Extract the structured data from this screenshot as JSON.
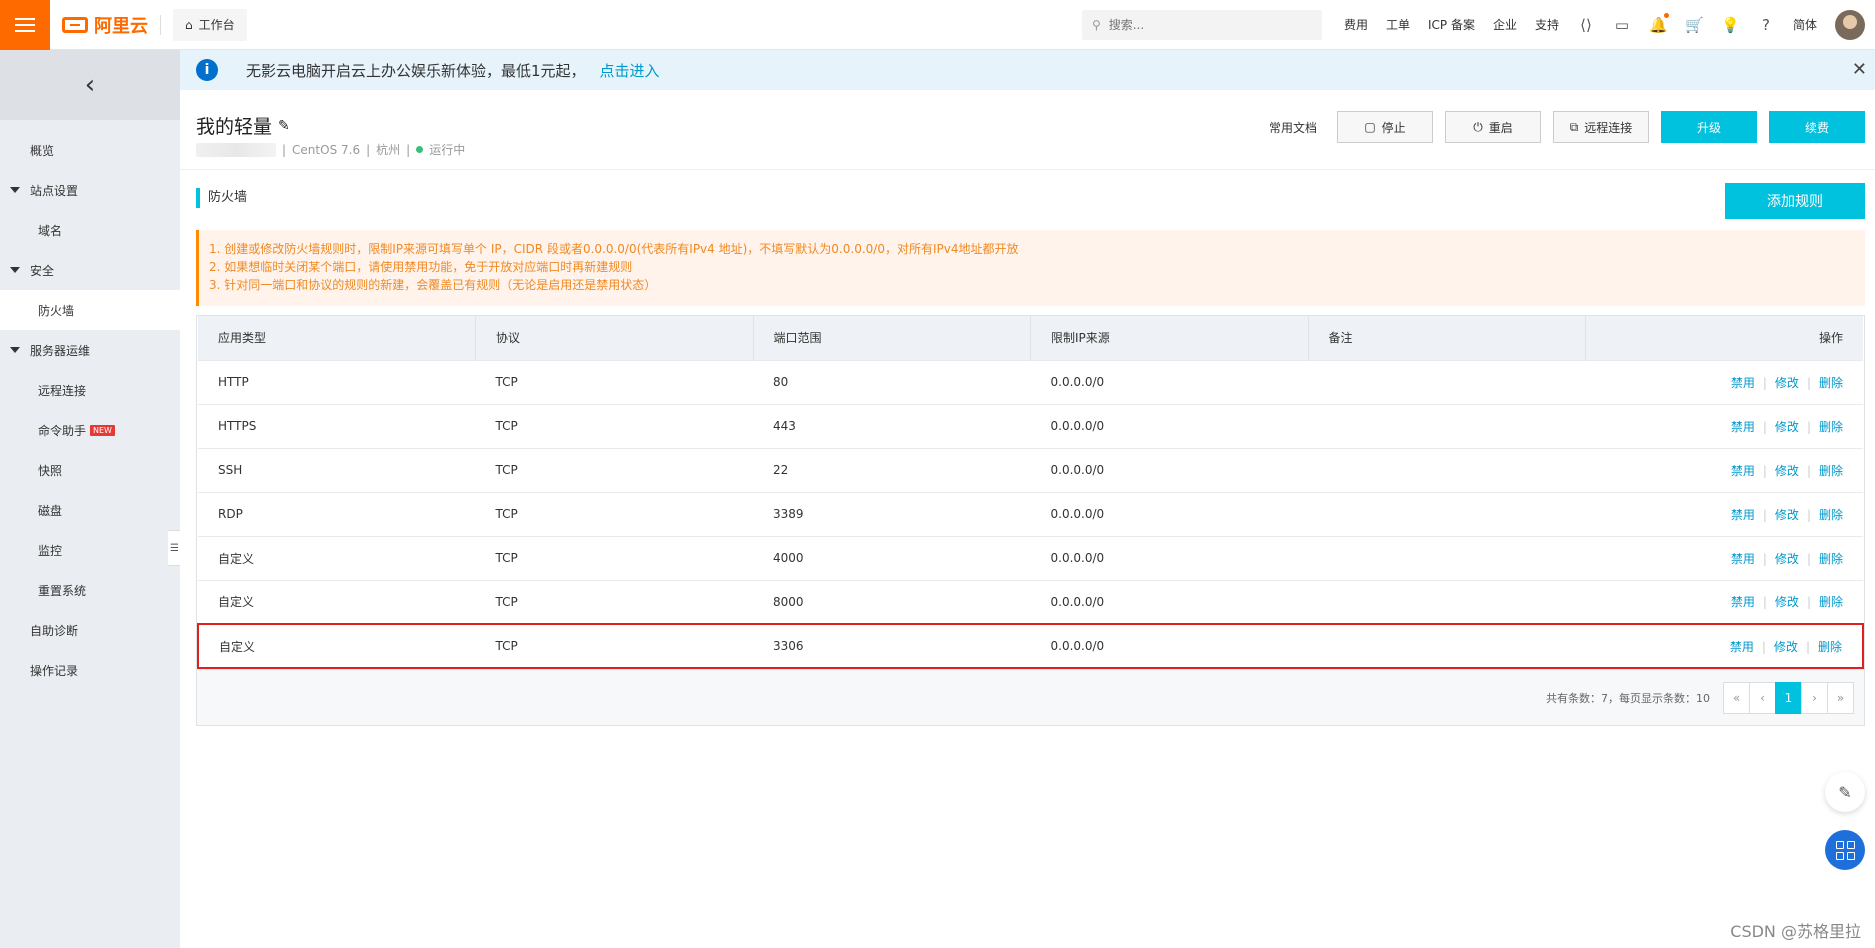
{
  "topbar": {
    "brand": "阿里云",
    "workbench": "工作台",
    "search_placeholder": "搜索...",
    "links": [
      "费用",
      "工单",
      "ICP 备案",
      "企业",
      "支持"
    ],
    "language": "简体",
    "accent": "#ff6a00"
  },
  "sidebar": {
    "items": [
      {
        "label": "概览"
      },
      {
        "label": "站点设置"
      },
      {
        "label": "域名"
      },
      {
        "label": "安全"
      },
      {
        "label": "防火墙"
      },
      {
        "label": "服务器运维"
      },
      {
        "label": "远程连接"
      },
      {
        "label": "命令助手"
      },
      {
        "label": "快照"
      },
      {
        "label": "磁盘"
      },
      {
        "label": "监控"
      },
      {
        "label": "重置系统"
      },
      {
        "label": "自助诊断"
      },
      {
        "label": "操作记录"
      }
    ],
    "new_badge": "NEW",
    "active": "防火墙"
  },
  "notice": {
    "text": "无影云电脑开启云上办公娱乐新体验，最低1元起，",
    "link": "点击进入"
  },
  "header": {
    "title": "我的轻量",
    "os": "CentOS 7.6",
    "region": "杭州",
    "status": "运行中",
    "doc_link": "常用文档",
    "buttons": {
      "stop": "停止",
      "restart": "重启",
      "remote": "远程连接",
      "upgrade": "升级",
      "renew": "续费"
    }
  },
  "firewall": {
    "title": "防火墙",
    "add_button": "添加规则",
    "notes": [
      "1. 创建或修改防火墙规则时，限制IP来源可填写单个 IP，CIDR 段或者0.0.0.0/0(代表所有IPv4 地址)，不填写默认为0.0.0.0/0，对所有IPv4地址都开放",
      "2. 如果想临时关闭某个端口，请使用禁用功能，免于开放对应端口时再新建规则",
      "3. 针对同一端口和协议的规则的新建，会覆盖已有规则（无论是启用还是禁用状态）"
    ],
    "columns": [
      "应用类型",
      "协议",
      "端口范围",
      "限制IP来源",
      "备注",
      "操作"
    ],
    "rows": [
      {
        "type": "HTTP",
        "protocol": "TCP",
        "port": "80",
        "source": "0.0.0.0/0",
        "remark": ""
      },
      {
        "type": "HTTPS",
        "protocol": "TCP",
        "port": "443",
        "source": "0.0.0.0/0",
        "remark": ""
      },
      {
        "type": "SSH",
        "protocol": "TCP",
        "port": "22",
        "source": "0.0.0.0/0",
        "remark": ""
      },
      {
        "type": "RDP",
        "protocol": "TCP",
        "port": "3389",
        "source": "0.0.0.0/0",
        "remark": ""
      },
      {
        "type": "自定义",
        "protocol": "TCP",
        "port": "4000",
        "source": "0.0.0.0/0",
        "remark": ""
      },
      {
        "type": "自定义",
        "protocol": "TCP",
        "port": "8000",
        "source": "0.0.0.0/0",
        "remark": ""
      },
      {
        "type": "自定义",
        "protocol": "TCP",
        "port": "3306",
        "source": "0.0.0.0/0",
        "remark": ""
      }
    ],
    "row_actions": [
      "禁用",
      "修改",
      "删除"
    ],
    "pager_info": "共有条数：7，每页显示条数：10",
    "pager": [
      "«",
      "‹",
      "1",
      "›",
      "»"
    ]
  },
  "watermark": "CSDN @苏格里拉"
}
